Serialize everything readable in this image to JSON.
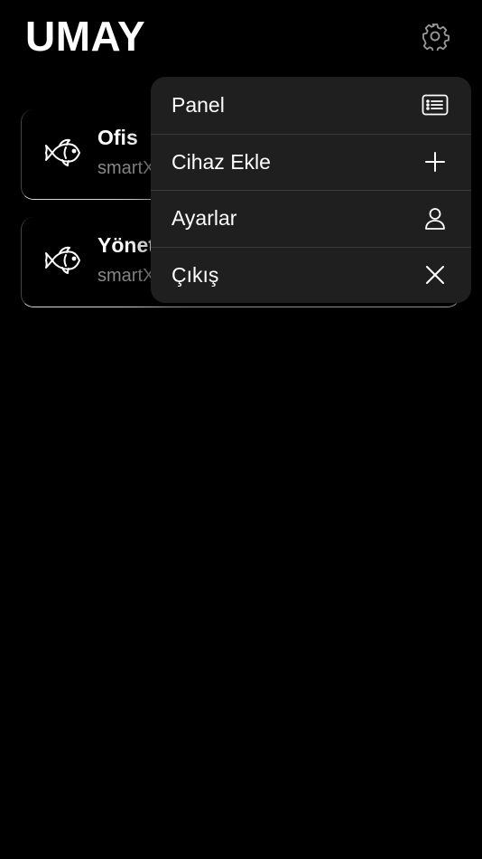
{
  "header": {
    "title": "UMAY",
    "settings_icon": "gear-icon"
  },
  "devices": [
    {
      "name": "Ofis",
      "subtitle": "smartX",
      "icon": "fish-icon"
    },
    {
      "name": "Yönet",
      "subtitle": "smartX",
      "icon": "fish-icon"
    }
  ],
  "menu": {
    "items": [
      {
        "label": "Panel",
        "icon": "list-icon"
      },
      {
        "label": "Cihaz Ekle",
        "icon": "plus-icon"
      },
      {
        "label": "Ayarlar",
        "icon": "person-icon"
      },
      {
        "label": "Çıkış",
        "icon": "close-icon"
      }
    ]
  },
  "colors": {
    "background": "#000000",
    "menu_background": "#1f1f1f",
    "subtitle": "#8a8a8a"
  }
}
